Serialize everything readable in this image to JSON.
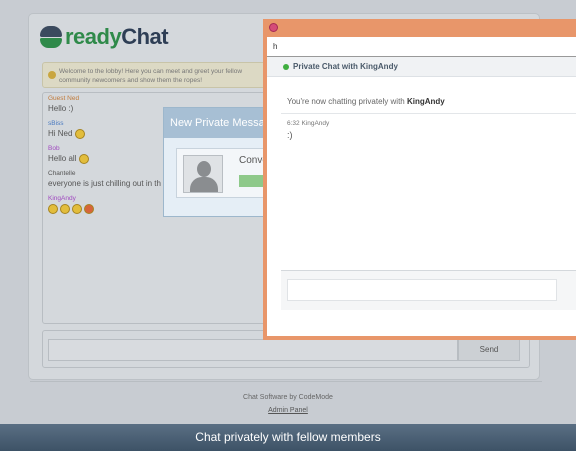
{
  "logo": {
    "ready": "ready",
    "chat": "Chat"
  },
  "welcome": {
    "text": "Welcome to the lobby! Here you can meet and greet your fellow community newcomers and show them the ropes!"
  },
  "messages": [
    {
      "user": "Guest Ned",
      "user_color": "#c07a3a",
      "text": "Hello :)",
      "smileys": 0
    },
    {
      "user": "sBiss",
      "user_color": "#4a7ac0",
      "text": "Hi Ned",
      "smileys": 1
    },
    {
      "user": "Bob",
      "user_color": "#a04ac0",
      "text": "Hello all",
      "smileys": 1
    },
    {
      "user": "Chantelle",
      "user_color": "#555555",
      "text": "everyone is just chilling out in th",
      "smileys": 0
    },
    {
      "user": "KingAndy",
      "user_color": "#a04ac0",
      "text": "",
      "smileys": 4
    }
  ],
  "send_button": "Send",
  "footer": {
    "credit": "Chat Software by CodeMode",
    "admin_link": "Admin Panel"
  },
  "new_private_messages": {
    "title": "New Private Messages",
    "item_label": "Conve"
  },
  "private_window": {
    "address_text": "h",
    "header": "Private Chat with KingAndy",
    "intro_prefix": "You're now chatting privately with ",
    "intro_user": "KingAndy",
    "message_meta": "6:32 KingAndy",
    "message_text": ":)"
  },
  "caption": "Chat privately with fellow members",
  "colors": {
    "accent_green": "#2f8a4a",
    "window_orange": "#e8966a",
    "online": "#3fae3f"
  }
}
